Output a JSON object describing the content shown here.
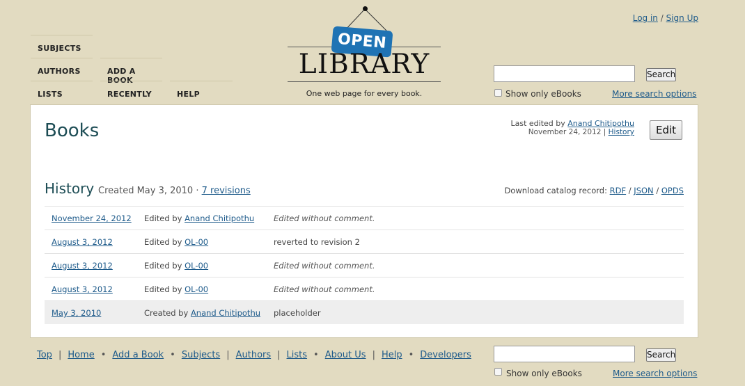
{
  "nav": {
    "subjects": "SUBJECTS",
    "authors": "AUTHORS",
    "add_book": "ADD A BOOK",
    "lists": "LISTS",
    "recently": "RECENTLY",
    "help": "HELP"
  },
  "auth": {
    "login": "Log in",
    "sep": "/",
    "signup": "Sign Up"
  },
  "logo": {
    "sign": "OPEN",
    "word": "LIBRARY",
    "tagline": "One web page for every book."
  },
  "search": {
    "button": "Search",
    "ebooks_label": "Show only eBooks",
    "more": "More search options",
    "value": ""
  },
  "page": {
    "title": "Books",
    "last_edited_prefix": "Last edited by",
    "last_edited_by": "Anand Chitipothu",
    "last_edited_date": "November 24, 2012",
    "pipe": "|",
    "history_link": "History",
    "edit_button": "Edit"
  },
  "history": {
    "title": "History",
    "created": "Created May 3, 2010 ·",
    "revisions": "7 revisions",
    "download_label": "Download catalog record:",
    "rdf": "RDF",
    "json": "JSON",
    "opds": "OPDS",
    "slash": "/",
    "rows": [
      {
        "date": "November 24, 2012",
        "action": "Edited by",
        "user": "Anand Chitipothu",
        "comment": "Edited without comment."
      },
      {
        "date": "August 3, 2012",
        "action": "Edited by",
        "user": "OL-00",
        "comment": "reverted to revision 2"
      },
      {
        "date": "August 3, 2012",
        "action": "Edited by",
        "user": "OL-00",
        "comment": "Edited without comment."
      },
      {
        "date": "August 3, 2012",
        "action": "Edited by",
        "user": "OL-00",
        "comment": "Edited without comment."
      },
      {
        "date": "May 3, 2010",
        "action": "Created by",
        "user": "Anand Chitipothu",
        "comment": "placeholder"
      }
    ]
  },
  "footer": {
    "top": "Top",
    "home": "Home",
    "add_book": "Add a Book",
    "subjects": "Subjects",
    "authors": "Authors",
    "lists": "Lists",
    "about": "About Us",
    "help": "Help",
    "developers": "Developers",
    "pipe": "|",
    "bullet": "•"
  }
}
